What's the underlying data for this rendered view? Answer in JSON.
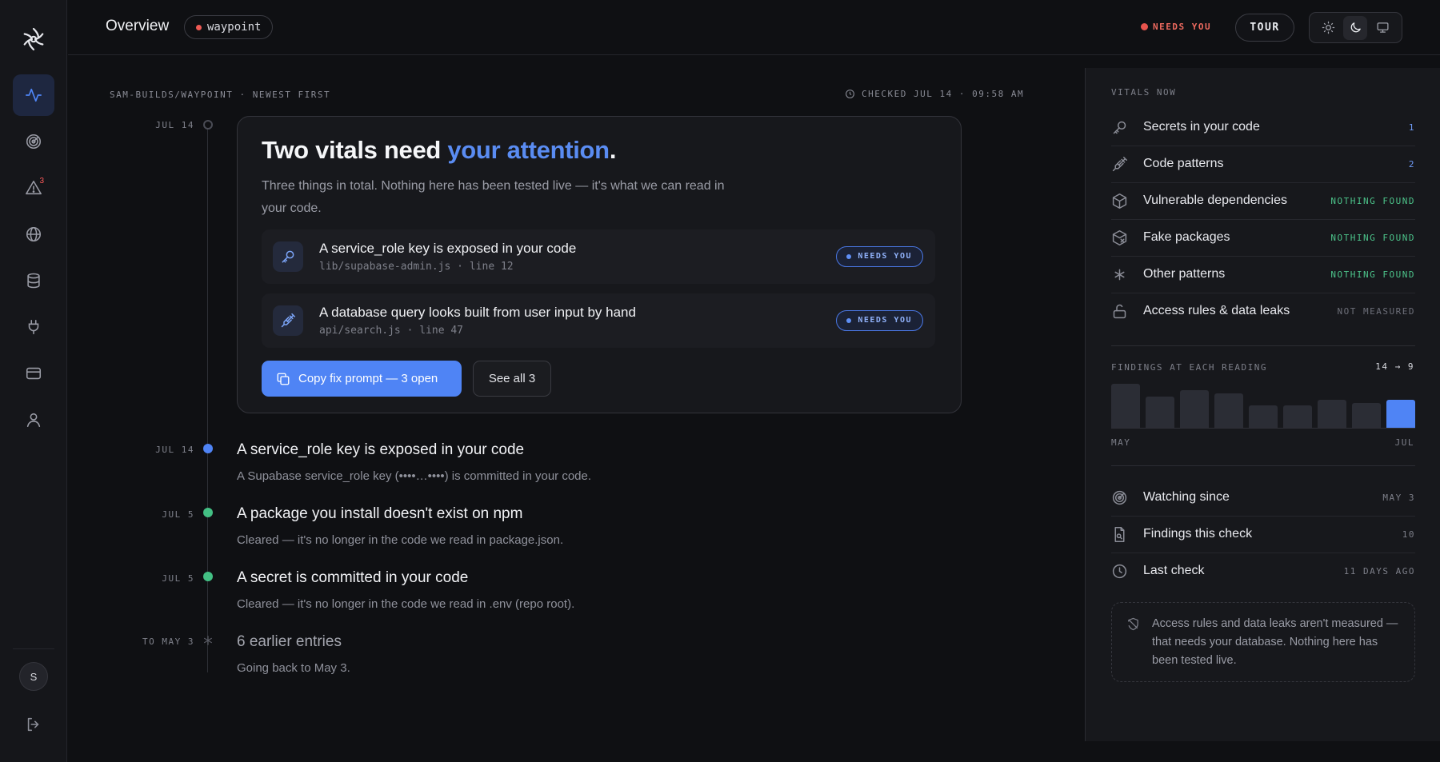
{
  "header": {
    "title": "Overview",
    "repo": "waypoint",
    "needs_you": "NEEDS YOU",
    "tour": "TOUR"
  },
  "sidebar": {
    "items": [
      {
        "name": "activity",
        "active": true
      },
      {
        "name": "radar"
      },
      {
        "name": "alerts",
        "badge": "3"
      },
      {
        "name": "globe"
      },
      {
        "name": "database"
      },
      {
        "name": "plug"
      },
      {
        "name": "billing"
      },
      {
        "name": "account"
      }
    ],
    "avatar_initial": "S"
  },
  "main": {
    "repo_label": "SAM-BUILDS/WAYPOINT · NEWEST FIRST",
    "checked": "CHECKED JUL 14 · 09:58 AM",
    "card": {
      "date": "JUL 14",
      "title_lead": "Two vitals need ",
      "title_accent": "your attention",
      "title_end": ".",
      "description": "Three things in total. Nothing here has been tested live — it's what we can read in your code.",
      "findings": [
        {
          "title": "A service_role key is exposed in your code",
          "file": "lib/supabase-admin.js · line 12",
          "status": "NEEDS YOU",
          "icon": "key-icon"
        },
        {
          "title": "A database query looks built from user input by hand",
          "file": "api/search.js · line 47",
          "status": "NEEDS YOU",
          "icon": "syringe-icon"
        }
      ],
      "copy_button": "Copy fix prompt — 3 open",
      "see_all_button": "See all 3"
    },
    "timeline": [
      {
        "date": "JUL 14",
        "title": "A service_role key is exposed in your code",
        "sub": "A Supabase service_role key (••••…••••) is committed in your code.",
        "status": "open"
      },
      {
        "date": "JUL 5",
        "title": "A package you install doesn't exist on npm",
        "sub": "Cleared — it's no longer in the code we read in package.json.",
        "status": "cleared"
      },
      {
        "date": "JUL 5",
        "title": "A secret is committed in your code",
        "sub": "Cleared — it's no longer in the code we read in .env (repo root).",
        "status": "cleared"
      },
      {
        "date": "TO MAY 3",
        "title": "6 earlier entries",
        "sub": "Going back to May 3.",
        "status": "older"
      }
    ]
  },
  "vitals": {
    "label": "VITALS NOW",
    "rows": [
      {
        "name": "Secrets in your code",
        "value": "1",
        "icon": "key-icon",
        "color": "#6f9bf7"
      },
      {
        "name": "Code patterns",
        "value": "2",
        "icon": "syringe-icon",
        "color": "#6f9bf7"
      },
      {
        "name": "Vulnerable dependencies",
        "value": "NOTHING FOUND",
        "icon": "package-icon",
        "color": "#4cc38a"
      },
      {
        "name": "Fake packages",
        "value": "NOTHING FOUND",
        "icon": "package-x-icon",
        "color": "#4cc38a"
      },
      {
        "name": "Other patterns",
        "value": "NOTHING FOUND",
        "icon": "asterisk-icon",
        "color": "#4cc38a"
      },
      {
        "name": "Access rules & data leaks",
        "value": "NOT MEASURED",
        "icon": "lock-open-icon",
        "color": "#6d6f79"
      }
    ],
    "findings_label": "FINDINGS AT EACH READING",
    "findings_range": "14 → 9",
    "findings_series": [
      14,
      10,
      12,
      11,
      7,
      7,
      9,
      8,
      9
    ],
    "axis_start": "MAY",
    "axis_end": "JUL",
    "meta": [
      {
        "name": "Watching since",
        "value": "MAY 3",
        "icon": "radar-icon"
      },
      {
        "name": "Findings this check",
        "value": "10",
        "icon": "file-search-icon"
      },
      {
        "name": "Last check",
        "value": "11 DAYS AGO",
        "icon": "clock-icon"
      }
    ],
    "note": "Access rules and data leaks aren't measured — that needs your database. Nothing here has been tested live."
  }
}
